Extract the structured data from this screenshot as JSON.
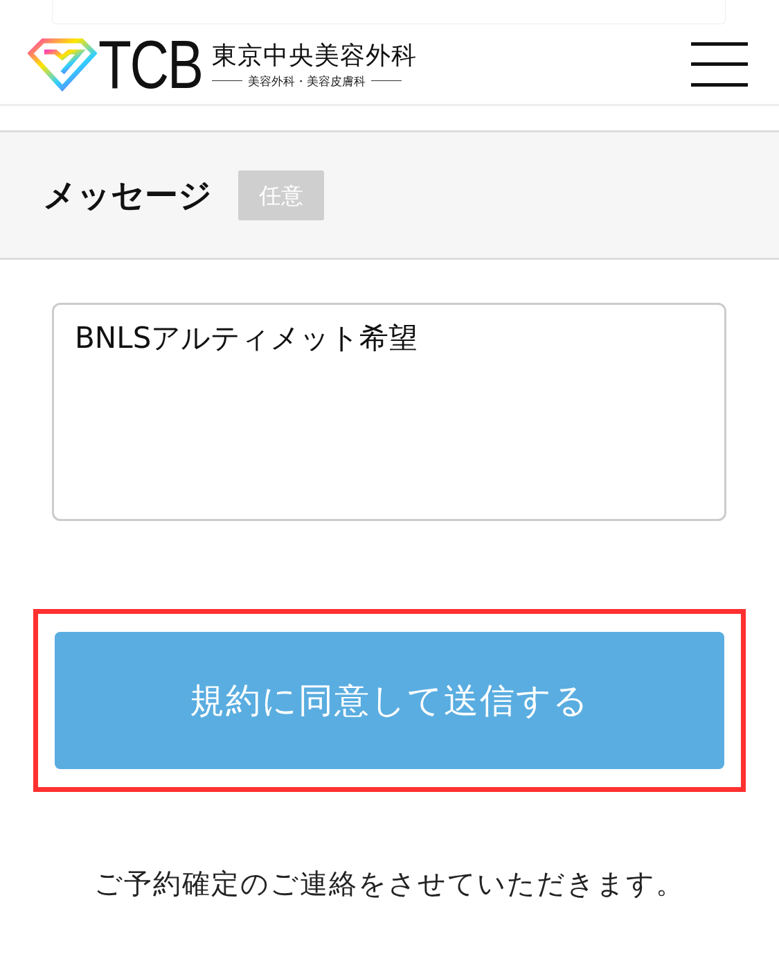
{
  "header": {
    "logo_mark": "TCB",
    "clinic_name": "東京中央美容外科",
    "tagline": "美容外科・美容皮膚科"
  },
  "message_field": {
    "label": "メッセージ",
    "badge": "任意",
    "value": "BNLSアルティメット希望"
  },
  "submit_button": {
    "label": "規約に同意して送信する",
    "highlighted": true
  },
  "note": "ご予約確定のご連絡をさせていただきます。"
}
